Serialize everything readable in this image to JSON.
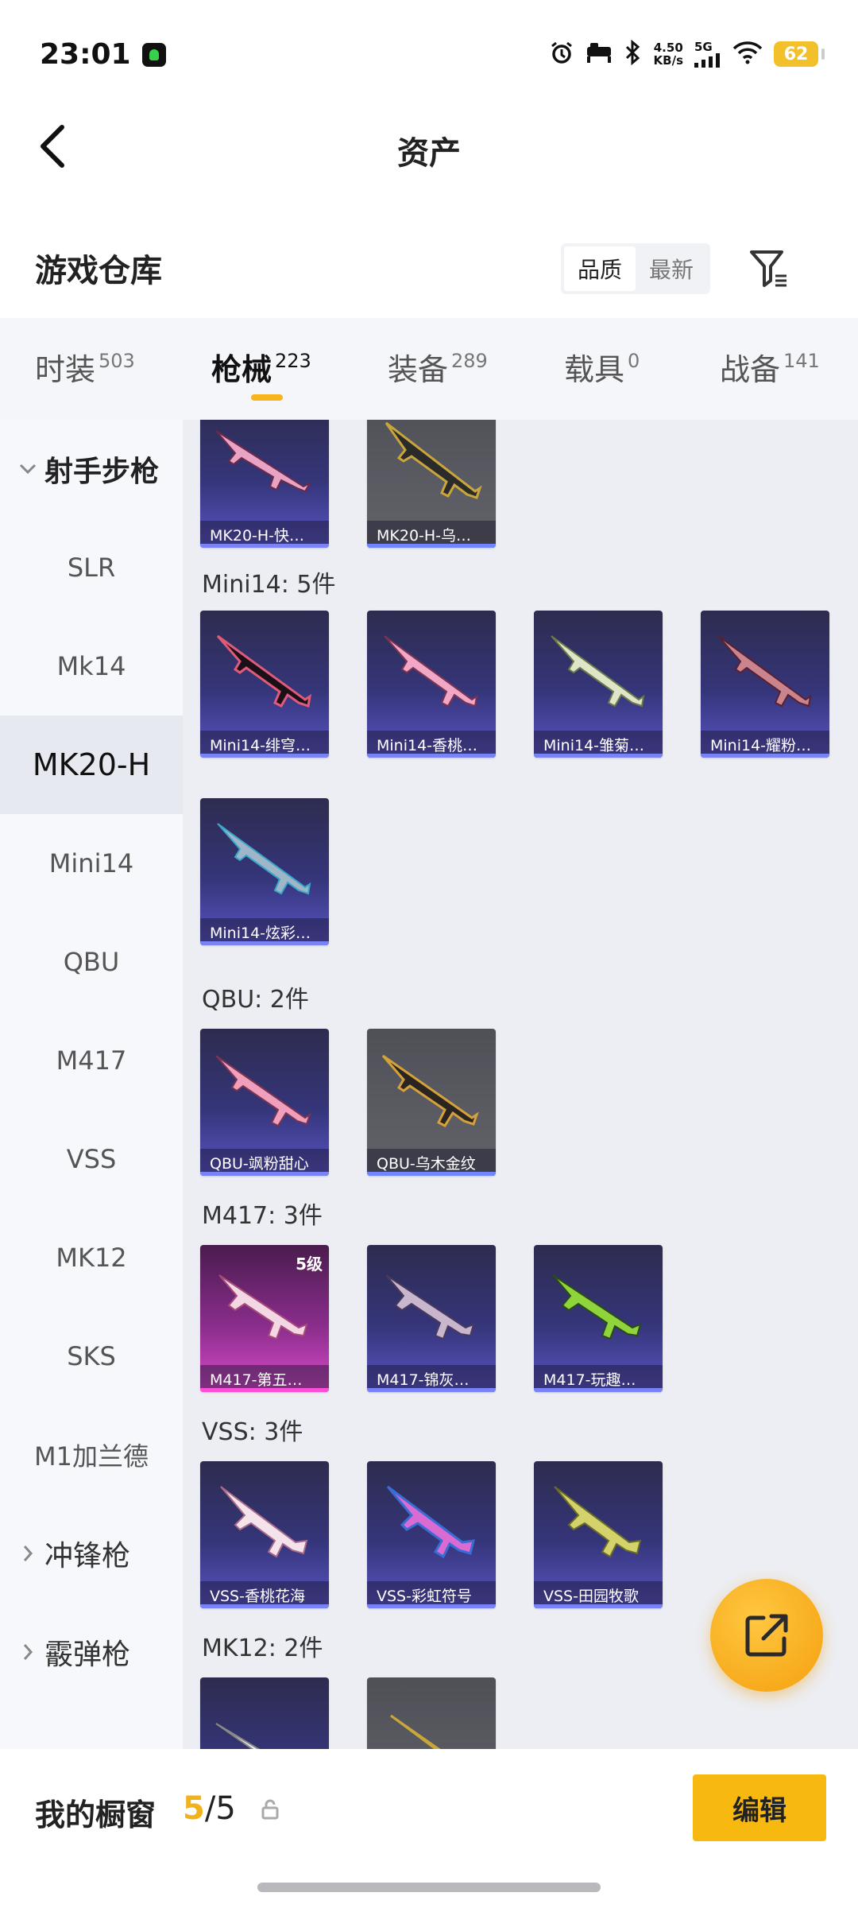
{
  "status_bar": {
    "time": "23:01",
    "speed_value": "4.50",
    "speed_unit": "KB/s",
    "network": "5G",
    "battery": "62",
    "icons": [
      "alarm-icon",
      "sleep-mode-icon",
      "bluetooth-icon",
      "signal-icon",
      "wifi-icon"
    ]
  },
  "header": {
    "title": "资产"
  },
  "section": {
    "title": "游戏仓库",
    "sort_options": [
      "品质",
      "最新"
    ],
    "active_sort": "品质"
  },
  "tabs": [
    {
      "label": "时装",
      "count": "503"
    },
    {
      "label": "枪械",
      "count": "223",
      "active": true
    },
    {
      "label": "装备",
      "count": "289"
    },
    {
      "label": "载具",
      "count": "0"
    },
    {
      "label": "战备",
      "count": "141"
    }
  ],
  "sidebar": {
    "group": "射手步枪",
    "items": [
      "SLR",
      "Mk14",
      "MK20-H",
      "Mini14",
      "QBU",
      "M417",
      "VSS",
      "MK12",
      "SKS",
      "M1加兰德"
    ],
    "selected": "MK20-H",
    "collapsed_groups": [
      "冲锋枪",
      "霰弹枪"
    ]
  },
  "content": {
    "mk20h_cards": [
      "MK20-H-快…",
      "MK20-H-乌…"
    ],
    "mini14": {
      "label": "Mini14: 5件",
      "cards": [
        "Mini14-绯穹…",
        "Mini14-香桃…",
        "Mini14-雏菊…",
        "Mini14-耀粉…",
        "Mini14-炫彩…"
      ]
    },
    "qbu": {
      "label": "QBU: 2件",
      "cards": [
        "QBU-飒粉甜心",
        "QBU-乌木金纹"
      ]
    },
    "m417": {
      "label": "M417: 3件",
      "cards": [
        "M417-第五…",
        "M417-锦灰…",
        "M417-玩趣…"
      ],
      "level_badge": "5级"
    },
    "vss": {
      "label": "VSS: 3件",
      "cards": [
        "VSS-香桃花海",
        "VSS-彩虹符号",
        "VSS-田园牧歌"
      ]
    },
    "mk12": {
      "label": "MK12: 2件"
    }
  },
  "bottom": {
    "label": "我的橱窗",
    "current": "5",
    "sep_total": "/5",
    "edit": "编辑"
  }
}
